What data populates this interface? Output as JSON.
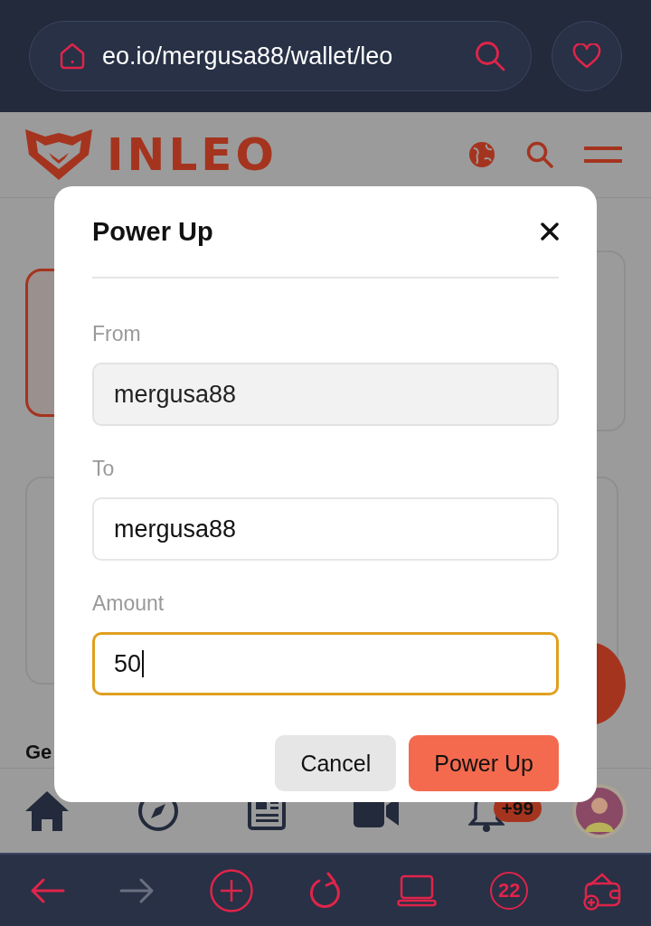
{
  "browser": {
    "url": "eo.io/mergusa88/wallet/leo"
  },
  "header": {
    "logo": "INLEO"
  },
  "page": {
    "heading": "Ge"
  },
  "modal": {
    "title": "Power Up",
    "fields": [
      {
        "label": "From",
        "value": "mergusa88",
        "disabled": true,
        "focused": false
      },
      {
        "label": "To",
        "value": "mergusa88",
        "disabled": false,
        "focused": false
      },
      {
        "label": "Amount",
        "value": "50",
        "disabled": false,
        "focused": true
      }
    ],
    "buttons": [
      {
        "label": "Cancel",
        "kind": "secondary"
      },
      {
        "label": "Power Up",
        "kind": "primary"
      }
    ]
  },
  "bottom_nav": [
    {
      "kind": "home"
    },
    {
      "kind": "compass"
    },
    {
      "kind": "news"
    },
    {
      "kind": "video"
    },
    {
      "kind": "bell",
      "badge": "+99"
    },
    {
      "kind": "avatar"
    }
  ],
  "toolbar": [
    {
      "kind": "back",
      "disabled": false
    },
    {
      "kind": "forward",
      "disabled": true
    },
    {
      "kind": "new-tab",
      "disabled": false
    },
    {
      "kind": "reload",
      "disabled": false
    },
    {
      "kind": "desktop",
      "disabled": false
    },
    {
      "kind": "tabs",
      "label": "22",
      "disabled": false
    },
    {
      "kind": "wallet",
      "disabled": false
    }
  ]
}
